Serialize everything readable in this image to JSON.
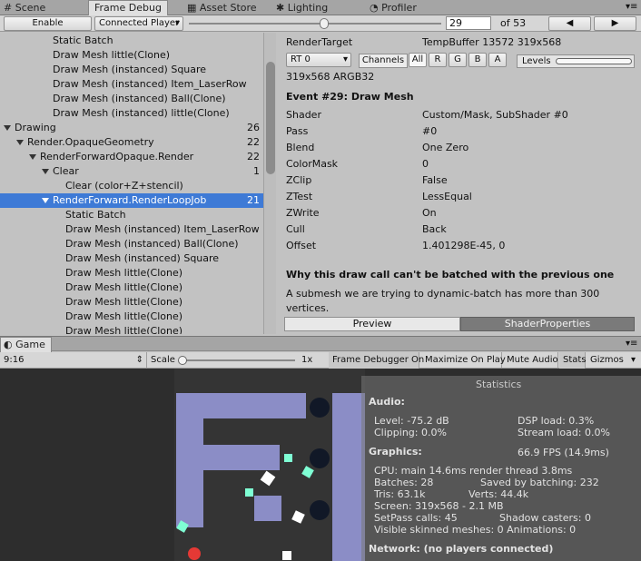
{
  "tabs": [
    {
      "label": "Scene"
    },
    {
      "label": "Frame Debug"
    },
    {
      "label": "Asset Store"
    },
    {
      "label": "Lighting"
    },
    {
      "label": "Profiler"
    }
  ],
  "toolbar": {
    "enable_label": "Enable",
    "player_label": "Connected Player",
    "event_value": "29",
    "event_total": "of 53"
  },
  "tree": [
    {
      "label": "Static Batch",
      "indent": 4
    },
    {
      "label": "Draw Mesh little(Clone)",
      "indent": 4
    },
    {
      "label": "Draw Mesh (instanced) Square",
      "indent": 4
    },
    {
      "label": "Draw Mesh (instanced) Item_LaserRow",
      "indent": 4
    },
    {
      "label": "Draw Mesh (instanced) Ball(Clone)",
      "indent": 4
    },
    {
      "label": "Draw Mesh (instanced) little(Clone)",
      "indent": 4
    },
    {
      "label": "Drawing",
      "indent": 1,
      "count": "26",
      "expand": true
    },
    {
      "label": "Render.OpaqueGeometry",
      "indent": 2,
      "count": "22",
      "expand": true
    },
    {
      "label": "RenderForwardOpaque.Render",
      "indent": 3,
      "count": "22",
      "expand": true
    },
    {
      "label": "Clear",
      "indent": 4,
      "count": "1",
      "expand": true
    },
    {
      "label": "Clear (color+Z+stencil)",
      "indent": 5
    },
    {
      "label": "RenderForward.RenderLoopJob",
      "indent": 4,
      "count": "21",
      "expand": true,
      "selected": true
    },
    {
      "label": "Static Batch",
      "indent": 5
    },
    {
      "label": "Draw Mesh (instanced) Item_LaserRow",
      "indent": 5
    },
    {
      "label": "Draw Mesh (instanced) Ball(Clone)",
      "indent": 5
    },
    {
      "label": "Draw Mesh (instanced) Square",
      "indent": 5
    },
    {
      "label": "Draw Mesh little(Clone)",
      "indent": 5
    },
    {
      "label": "Draw Mesh little(Clone)",
      "indent": 5
    },
    {
      "label": "Draw Mesh little(Clone)",
      "indent": 5
    },
    {
      "label": "Draw Mesh little(Clone)",
      "indent": 5
    },
    {
      "label": "Draw Mesh little(Clone)",
      "indent": 5
    }
  ],
  "detail": {
    "rt_key": "RenderTarget",
    "rt_value": "TempBuffer 13572 319x568",
    "rt_select": "RT 0",
    "channels_label": "Channels",
    "channels": [
      "All",
      "R",
      "G",
      "B",
      "A"
    ],
    "levels_label": "Levels",
    "format": "319x568 ARGB32",
    "event_title": "Event #29: Draw Mesh",
    "props": [
      {
        "k": "Shader",
        "v": "Custom/Mask, SubShader #0"
      },
      {
        "k": "Pass",
        "v": "#0"
      },
      {
        "k": "Blend",
        "v": "One Zero"
      },
      {
        "k": "ColorMask",
        "v": "0"
      },
      {
        "k": "ZClip",
        "v": "False"
      },
      {
        "k": "ZTest",
        "v": "LessEqual"
      },
      {
        "k": "ZWrite",
        "v": "On"
      },
      {
        "k": "Cull",
        "v": "Back"
      },
      {
        "k": "Offset",
        "v": "1.401298E-45, 0"
      }
    ],
    "batch_title": "Why this draw call can't be batched with the previous one",
    "batch_reason": "A submesh we are trying to dynamic-batch has more than 300 vertices.",
    "tab_preview": "Preview",
    "tab_shader": "ShaderProperties"
  },
  "game": {
    "tab_label": "Game",
    "aspect": "9:16",
    "scale_label": "Scale",
    "scale_value": "1x",
    "buttons": [
      "Frame Debugger On",
      "Maximize On Play",
      "Mute Audio",
      "Stats",
      "Gizmos"
    ]
  },
  "stats": {
    "title": "Statistics",
    "audio_header": "Audio:",
    "level": "Level: -75.2 dB",
    "dsp": "DSP load: 0.3%",
    "clipping": "Clipping: 0.0%",
    "stream": "Stream load: 0.0%",
    "graphics_header": "Graphics:",
    "fps": "66.9 FPS (14.9ms)",
    "cpu": "CPU: main 14.6ms  render thread 3.8ms",
    "batches": "Batches: 28",
    "saved": "Saved by batching: 232",
    "tris": "Tris: 63.1k",
    "verts": "Verts: 44.4k",
    "screen": "Screen: 319x568 - 2.1 MB",
    "setpass": "SetPass calls: 45",
    "shadow": "Shadow casters: 0",
    "skinned": "Visible skinned meshes: 0  Animations: 0",
    "network": "Network: (no players connected)"
  }
}
